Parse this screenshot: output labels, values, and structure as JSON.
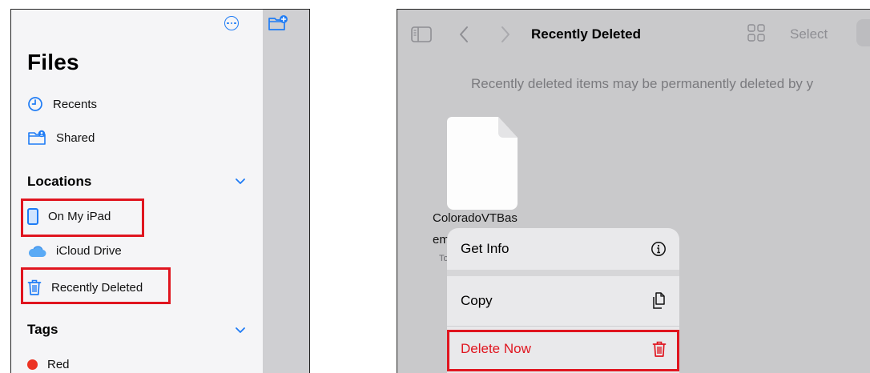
{
  "left": {
    "title": "Files",
    "recents_label": "Recents",
    "shared_label": "Shared",
    "locations_header": "Locations",
    "on_my_ipad_label": "On My iPad",
    "icloud_label": "iCloud Drive",
    "recently_deleted_label": "Recently Deleted",
    "tags_header": "Tags",
    "red_tag_label": "Red"
  },
  "right": {
    "nav_title": "Recently Deleted",
    "select_label": "Select",
    "notice": "Recently deleted items may be permanently deleted by y",
    "file_name_line1": "ColoradoVTBas",
    "file_name_line2": "em",
    "file_meta_fragment": "To",
    "menu": {
      "get_info": "Get Info",
      "copy": "Copy",
      "delete_now": "Delete Now"
    }
  },
  "colors": {
    "accent": "#1f7cf5",
    "destructive": "#e0151f",
    "highlight_box": "#e0151f",
    "tag_red": "#ec3323"
  }
}
